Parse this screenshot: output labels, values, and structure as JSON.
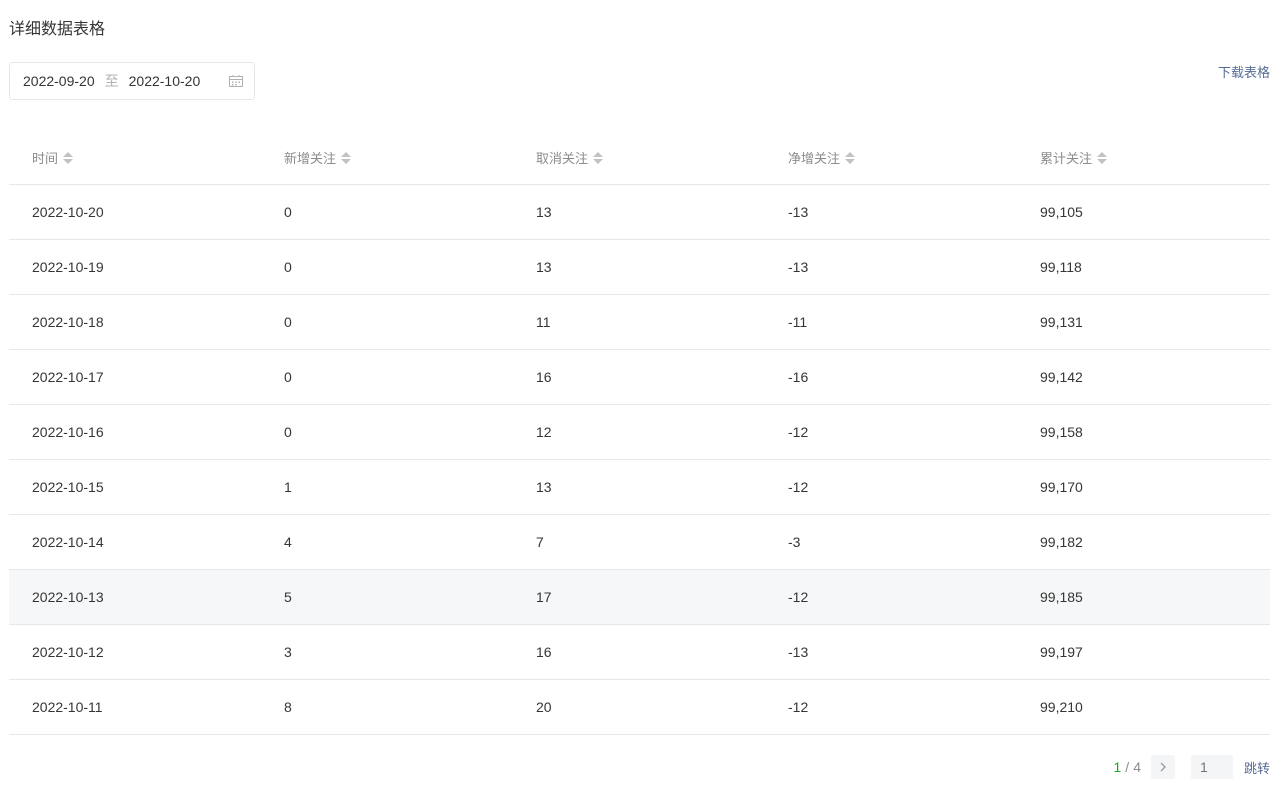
{
  "section_title": "详细数据表格",
  "date_range": {
    "start": "2022-09-20",
    "separator": "至",
    "end": "2022-10-20"
  },
  "download_label": "下载表格",
  "table": {
    "headers": [
      "时间",
      "新增关注",
      "取消关注",
      "净增关注",
      "累计关注"
    ],
    "rows": [
      [
        "2022-10-20",
        "0",
        "13",
        "-13",
        "99,105"
      ],
      [
        "2022-10-19",
        "0",
        "13",
        "-13",
        "99,118"
      ],
      [
        "2022-10-18",
        "0",
        "11",
        "-11",
        "99,131"
      ],
      [
        "2022-10-17",
        "0",
        "16",
        "-16",
        "99,142"
      ],
      [
        "2022-10-16",
        "0",
        "12",
        "-12",
        "99,158"
      ],
      [
        "2022-10-15",
        "1",
        "13",
        "-12",
        "99,170"
      ],
      [
        "2022-10-14",
        "4",
        "7",
        "-3",
        "99,182"
      ],
      [
        "2022-10-13",
        "5",
        "17",
        "-12",
        "99,185"
      ],
      [
        "2022-10-12",
        "3",
        "16",
        "-13",
        "99,197"
      ],
      [
        "2022-10-11",
        "8",
        "20",
        "-12",
        "99,210"
      ]
    ],
    "hovered_row_index": 7
  },
  "pagination": {
    "current": "1",
    "separator": "/",
    "total": "4",
    "jump_placeholder": "1",
    "jump_label": "跳转"
  },
  "colors": {
    "accent_green": "#1aad19",
    "link_blue": "#576b95"
  },
  "icons": {
    "calendar": "calendar-icon",
    "sort": "sort-icon",
    "next": "chevron-right-icon"
  }
}
